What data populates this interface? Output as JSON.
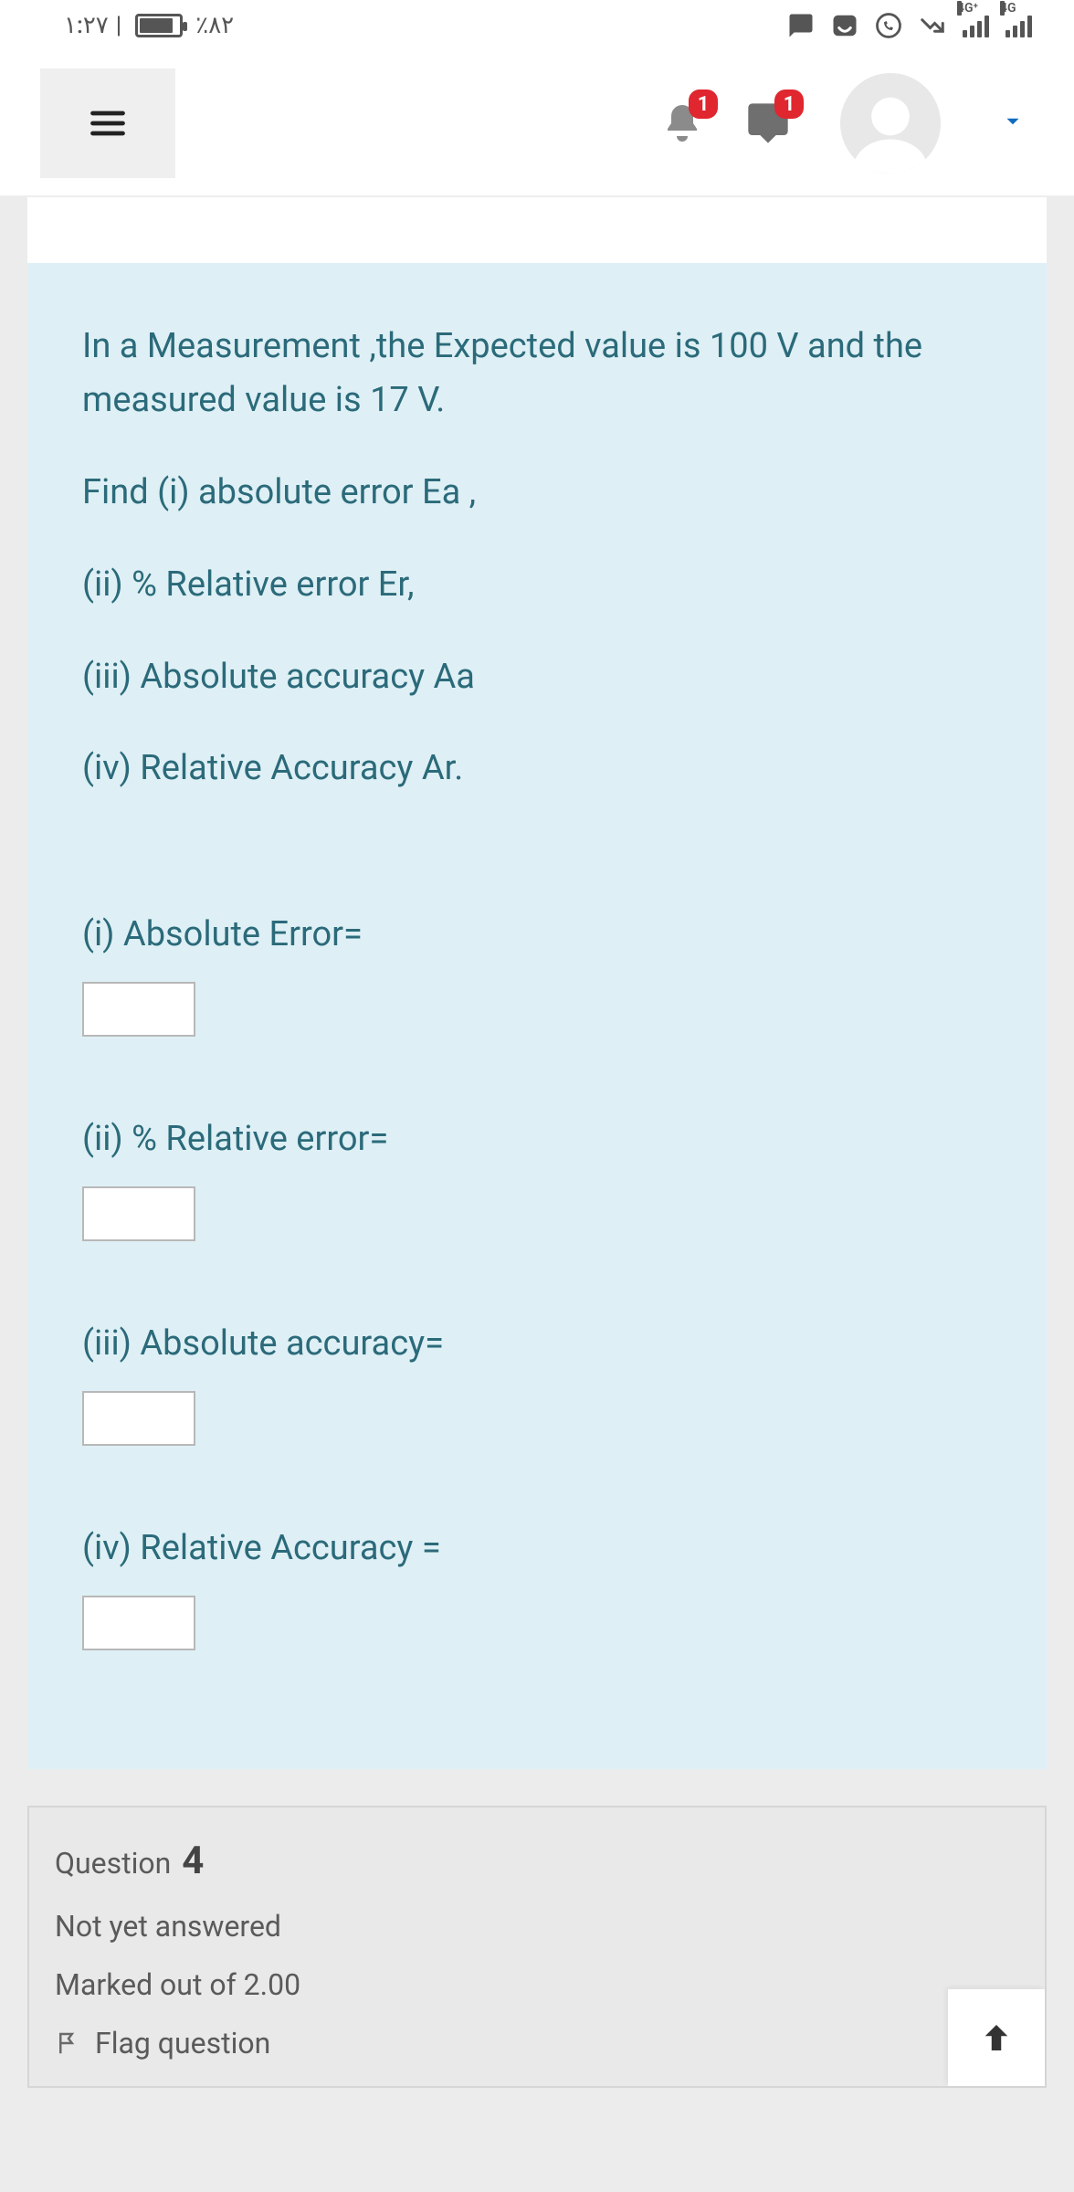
{
  "statusbar": {
    "time": "١:٢٧",
    "battery_text": "٪٨٢",
    "net1_label": "4G⁺",
    "net2_label": "4G"
  },
  "header": {
    "notif_badge": "1",
    "chat_badge": "1"
  },
  "question": {
    "prompt_lines": [
      "In a Measurement ,the Expected value is 100 V and the measured value is 17 V.",
      "Find  (i) absolute error Ea ,",
      "(ii) % Relative error Er,",
      "(iii) Absolute accuracy Aa",
      "(iv) Relative Accuracy Ar."
    ],
    "answers": [
      {
        "label": "(i) Absolute Error=",
        "value": ""
      },
      {
        "label": "(ii) % Relative error=",
        "value": ""
      },
      {
        "label": "(iii) Absolute accuracy=",
        "value": ""
      },
      {
        "label": "(iv) Relative Accuracy =",
        "value": ""
      }
    ]
  },
  "qinfo": {
    "label": "Question",
    "number": "4",
    "status": "Not yet answered",
    "marks": "Marked out of 2.00",
    "flag": "Flag question"
  }
}
